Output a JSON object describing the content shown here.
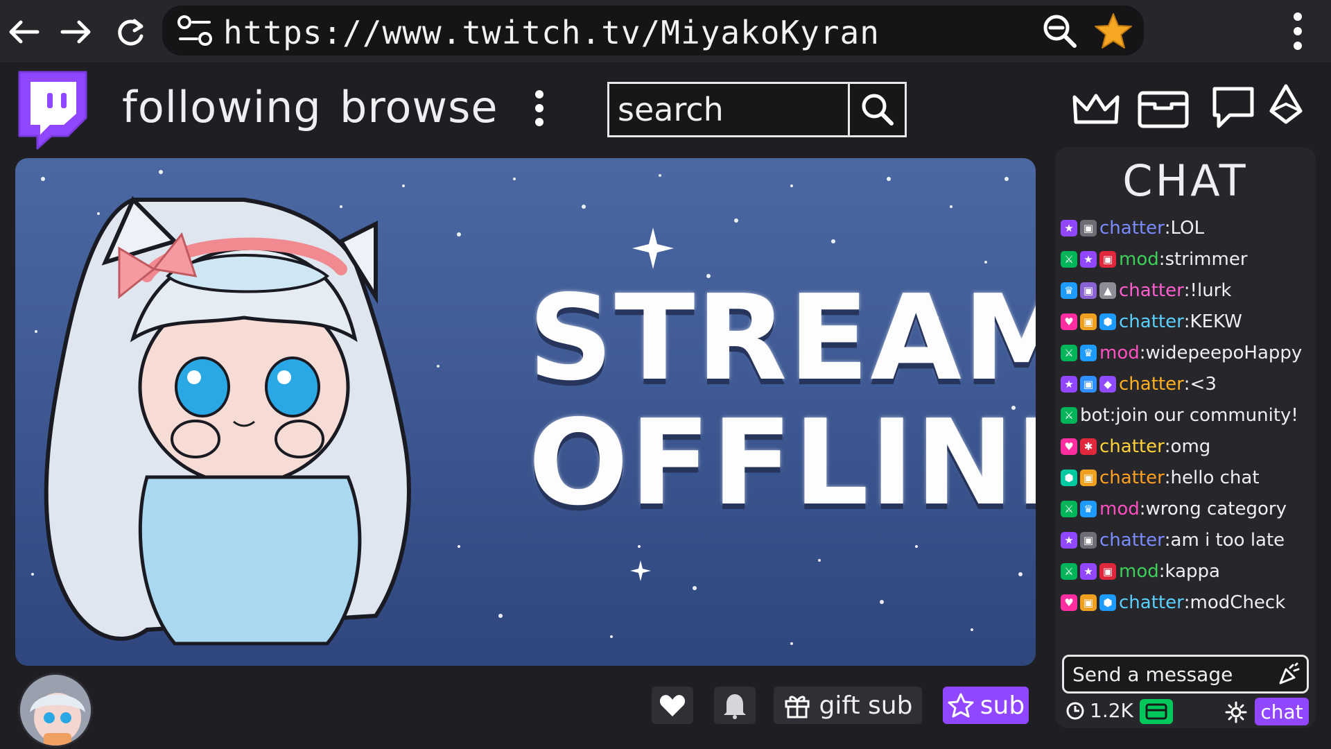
{
  "browser": {
    "url": "https://www.twitch.tv/MiyakoKyran"
  },
  "header": {
    "following_label": "following",
    "browse_label": "browse",
    "search_placeholder": "search"
  },
  "stream": {
    "offline_line1": "STREAM",
    "offline_line2": "OFFLINE"
  },
  "actions": {
    "gift_label": "gift sub",
    "sub_label": "sub"
  },
  "chat": {
    "title": "CHAT",
    "messages": [
      {
        "badges": [
          "purple-star",
          "gray-gift"
        ],
        "user": "chatter",
        "user_color": "#7b8cff",
        "text": "LOL"
      },
      {
        "badges": [
          "green-sword",
          "purple-star",
          "red-gift"
        ],
        "user": "mod",
        "user_color": "#3dcf5a",
        "text": "strimmer"
      },
      {
        "badges": [
          "blue-crown",
          "purple-gift",
          "gray-hat"
        ],
        "user": "chatter",
        "user_color": "#ff5fd0",
        "text": "!lurk"
      },
      {
        "badges": [
          "pink-heart",
          "gold-gift",
          "blue-gem"
        ],
        "user": "chatter",
        "user_color": "#5ad0ff",
        "text": "KEKW"
      },
      {
        "badges": [
          "green-sword",
          "blue-crown"
        ],
        "user": "mod",
        "user_color": "#ff4fc0",
        "text": "widepeepoHappy"
      },
      {
        "badges": [
          "purple-star",
          "blue-gift",
          "purple-gem"
        ],
        "user": "chatter",
        "user_color": "#ffb020",
        "text": " <3"
      },
      {
        "badges": [
          "green-sword"
        ],
        "user": "bot",
        "user_color": "#efeff1",
        "text": " join our community!"
      },
      {
        "badges": [
          "pink-heart",
          "red-star"
        ],
        "user": "chatter",
        "user_color": "#ffd23a",
        "text": " omg"
      },
      {
        "badges": [
          "teal-gem",
          "gold-gift"
        ],
        "user": "chatter",
        "user_color": "#ffa020",
        "text": "hello chat"
      },
      {
        "badges": [
          "green-sword",
          "blue-crown"
        ],
        "user": "mod",
        "user_color": "#ff4fc0",
        "text": "wrong category"
      },
      {
        "badges": [
          "purple-star",
          "gray-gift"
        ],
        "user": "chatter",
        "user_color": "#7b8cff",
        "text": " am i too late"
      },
      {
        "badges": [
          "green-sword",
          "purple-star",
          "red-gift"
        ],
        "user": "mod",
        "user_color": "#3dcf5a",
        "text": " kappa"
      },
      {
        "badges": [
          "pink-heart",
          "gold-gift",
          "blue-gem"
        ],
        "user": "chatter",
        "user_color": "#5ad0ff",
        "text": " modCheck"
      }
    ],
    "message_placeholder": "Send a message",
    "points": "1.2K",
    "chat_button_label": "chat"
  },
  "colors": {
    "brand_purple": "#9147ff",
    "background": "#1f1f23",
    "panel": "#26262b",
    "stream_sky": "#3c5690",
    "points_green": "#00c85a"
  },
  "badge_colors": {
    "purple-star": "#9147ff",
    "gray-gift": "#6d6d76",
    "green-sword": "#00b45a",
    "red-gift": "#e0283c",
    "blue-crown": "#1e9bff",
    "purple-gift": "#8a63d2",
    "gray-hat": "#8e8e96",
    "pink-heart": "#ff2ea0",
    "gold-gift": "#f0a020",
    "blue-gem": "#1e9bff",
    "blue-gift": "#2f8fff",
    "purple-gem": "#8e4bff",
    "red-star": "#e0283c",
    "teal-gem": "#00c8a0"
  }
}
